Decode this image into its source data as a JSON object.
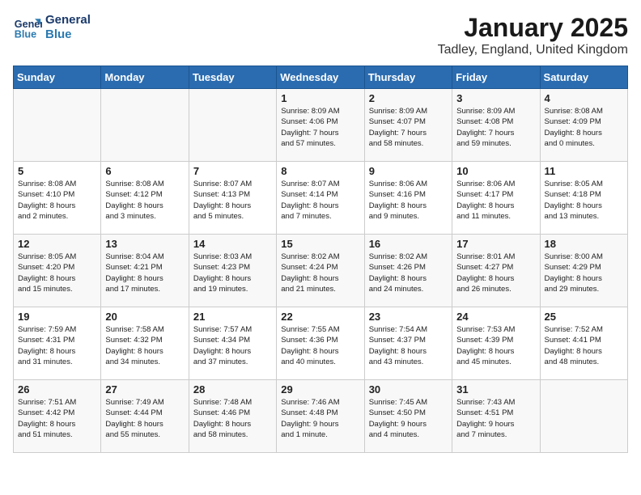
{
  "logo": {
    "line1": "General",
    "line2": "Blue"
  },
  "title": "January 2025",
  "subtitle": "Tadley, England, United Kingdom",
  "days_of_week": [
    "Sunday",
    "Monday",
    "Tuesday",
    "Wednesday",
    "Thursday",
    "Friday",
    "Saturday"
  ],
  "weeks": [
    [
      {
        "day": "",
        "info": ""
      },
      {
        "day": "",
        "info": ""
      },
      {
        "day": "",
        "info": ""
      },
      {
        "day": "1",
        "info": "Sunrise: 8:09 AM\nSunset: 4:06 PM\nDaylight: 7 hours\nand 57 minutes."
      },
      {
        "day": "2",
        "info": "Sunrise: 8:09 AM\nSunset: 4:07 PM\nDaylight: 7 hours\nand 58 minutes."
      },
      {
        "day": "3",
        "info": "Sunrise: 8:09 AM\nSunset: 4:08 PM\nDaylight: 7 hours\nand 59 minutes."
      },
      {
        "day": "4",
        "info": "Sunrise: 8:08 AM\nSunset: 4:09 PM\nDaylight: 8 hours\nand 0 minutes."
      }
    ],
    [
      {
        "day": "5",
        "info": "Sunrise: 8:08 AM\nSunset: 4:10 PM\nDaylight: 8 hours\nand 2 minutes."
      },
      {
        "day": "6",
        "info": "Sunrise: 8:08 AM\nSunset: 4:12 PM\nDaylight: 8 hours\nand 3 minutes."
      },
      {
        "day": "7",
        "info": "Sunrise: 8:07 AM\nSunset: 4:13 PM\nDaylight: 8 hours\nand 5 minutes."
      },
      {
        "day": "8",
        "info": "Sunrise: 8:07 AM\nSunset: 4:14 PM\nDaylight: 8 hours\nand 7 minutes."
      },
      {
        "day": "9",
        "info": "Sunrise: 8:06 AM\nSunset: 4:16 PM\nDaylight: 8 hours\nand 9 minutes."
      },
      {
        "day": "10",
        "info": "Sunrise: 8:06 AM\nSunset: 4:17 PM\nDaylight: 8 hours\nand 11 minutes."
      },
      {
        "day": "11",
        "info": "Sunrise: 8:05 AM\nSunset: 4:18 PM\nDaylight: 8 hours\nand 13 minutes."
      }
    ],
    [
      {
        "day": "12",
        "info": "Sunrise: 8:05 AM\nSunset: 4:20 PM\nDaylight: 8 hours\nand 15 minutes."
      },
      {
        "day": "13",
        "info": "Sunrise: 8:04 AM\nSunset: 4:21 PM\nDaylight: 8 hours\nand 17 minutes."
      },
      {
        "day": "14",
        "info": "Sunrise: 8:03 AM\nSunset: 4:23 PM\nDaylight: 8 hours\nand 19 minutes."
      },
      {
        "day": "15",
        "info": "Sunrise: 8:02 AM\nSunset: 4:24 PM\nDaylight: 8 hours\nand 21 minutes."
      },
      {
        "day": "16",
        "info": "Sunrise: 8:02 AM\nSunset: 4:26 PM\nDaylight: 8 hours\nand 24 minutes."
      },
      {
        "day": "17",
        "info": "Sunrise: 8:01 AM\nSunset: 4:27 PM\nDaylight: 8 hours\nand 26 minutes."
      },
      {
        "day": "18",
        "info": "Sunrise: 8:00 AM\nSunset: 4:29 PM\nDaylight: 8 hours\nand 29 minutes."
      }
    ],
    [
      {
        "day": "19",
        "info": "Sunrise: 7:59 AM\nSunset: 4:31 PM\nDaylight: 8 hours\nand 31 minutes."
      },
      {
        "day": "20",
        "info": "Sunrise: 7:58 AM\nSunset: 4:32 PM\nDaylight: 8 hours\nand 34 minutes."
      },
      {
        "day": "21",
        "info": "Sunrise: 7:57 AM\nSunset: 4:34 PM\nDaylight: 8 hours\nand 37 minutes."
      },
      {
        "day": "22",
        "info": "Sunrise: 7:55 AM\nSunset: 4:36 PM\nDaylight: 8 hours\nand 40 minutes."
      },
      {
        "day": "23",
        "info": "Sunrise: 7:54 AM\nSunset: 4:37 PM\nDaylight: 8 hours\nand 43 minutes."
      },
      {
        "day": "24",
        "info": "Sunrise: 7:53 AM\nSunset: 4:39 PM\nDaylight: 8 hours\nand 45 minutes."
      },
      {
        "day": "25",
        "info": "Sunrise: 7:52 AM\nSunset: 4:41 PM\nDaylight: 8 hours\nand 48 minutes."
      }
    ],
    [
      {
        "day": "26",
        "info": "Sunrise: 7:51 AM\nSunset: 4:42 PM\nDaylight: 8 hours\nand 51 minutes."
      },
      {
        "day": "27",
        "info": "Sunrise: 7:49 AM\nSunset: 4:44 PM\nDaylight: 8 hours\nand 55 minutes."
      },
      {
        "day": "28",
        "info": "Sunrise: 7:48 AM\nSunset: 4:46 PM\nDaylight: 8 hours\nand 58 minutes."
      },
      {
        "day": "29",
        "info": "Sunrise: 7:46 AM\nSunset: 4:48 PM\nDaylight: 9 hours\nand 1 minute."
      },
      {
        "day": "30",
        "info": "Sunrise: 7:45 AM\nSunset: 4:50 PM\nDaylight: 9 hours\nand 4 minutes."
      },
      {
        "day": "31",
        "info": "Sunrise: 7:43 AM\nSunset: 4:51 PM\nDaylight: 9 hours\nand 7 minutes."
      },
      {
        "day": "",
        "info": ""
      }
    ]
  ]
}
